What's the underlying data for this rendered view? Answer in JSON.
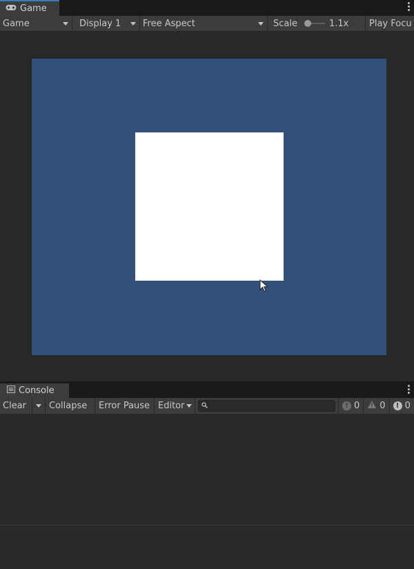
{
  "game_window": {
    "tab_label": "Game",
    "tab_icon": "gamepad-icon",
    "toolbar": {
      "mode": "Game",
      "display": "Display 1",
      "aspect": "Free Aspect",
      "scale_label": "Scale",
      "scale_value": "1.1x",
      "scale_slider_fraction": 0.0,
      "play_focus": "Play Focu"
    },
    "viewport": {
      "background_color": "#325078",
      "quad_color": "#ffffff"
    }
  },
  "console_window": {
    "tab_label": "Console",
    "tab_icon": "console-list-icon",
    "toolbar": {
      "clear": "Clear",
      "collapse": "Collapse",
      "error_pause": "Error Pause",
      "editor": "Editor",
      "search_placeholder": ""
    },
    "counts": {
      "info": "0",
      "warning": "0",
      "error": "0"
    }
  }
}
